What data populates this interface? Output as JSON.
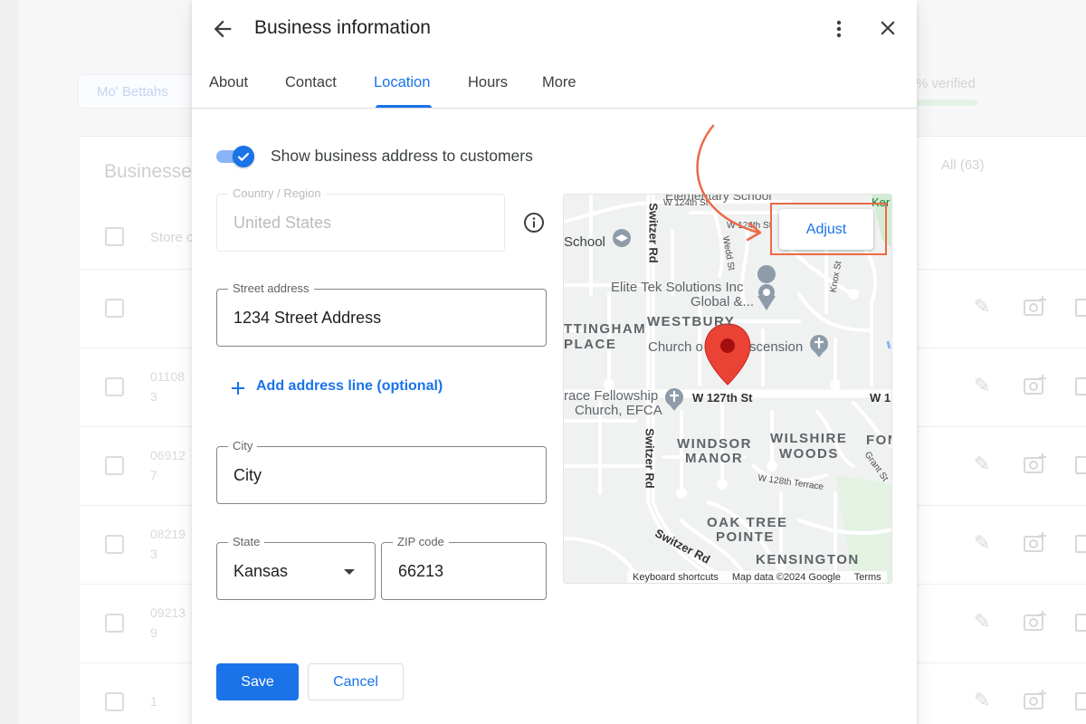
{
  "background": {
    "business_chip": "Mo' Bettahs",
    "verified_text": "% verified",
    "heading": "Businesses",
    "all_count": "All (63)",
    "store_column": "Store c",
    "rows": [
      {
        "id_line1": "",
        "id_line2": ""
      },
      {
        "id_line1": "01108",
        "id_line2": "3"
      },
      {
        "id_line1": "06912",
        "id_line2": "7"
      },
      {
        "id_line1": "08219",
        "id_line2": "3"
      },
      {
        "id_line1": "09213",
        "id_line2": "9"
      },
      {
        "id_line1": "1",
        "id_line2": ""
      }
    ]
  },
  "dialog": {
    "title": "Business information",
    "tabs": [
      {
        "label": "About"
      },
      {
        "label": "Contact"
      },
      {
        "label": "Location"
      },
      {
        "label": "Hours"
      },
      {
        "label": "More"
      }
    ],
    "active_tab": "Location",
    "toggle": {
      "label": "Show business address to customers",
      "checked": true
    },
    "country": {
      "label": "Country / Region",
      "value": "United States",
      "disabled": true
    },
    "street": {
      "label": "Street address",
      "value": "1234 Street Address"
    },
    "add_line_label": "Add address line (optional)",
    "city": {
      "label": "City",
      "value": "City"
    },
    "state": {
      "label": "State",
      "value": "Kansas"
    },
    "zip": {
      "label": "ZIP code",
      "value": "66213"
    },
    "save_label": "Save",
    "cancel_label": "Cancel"
  },
  "map": {
    "adjust_label": "Adjust",
    "labels": {
      "school_top": "Elementary School",
      "school": "School",
      "w124_1": "W 124th St",
      "w124_2": "W 124th St",
      "wedd": "Wedd St",
      "knox": "Knox St",
      "switzer_top": "Switzer Rd",
      "elite_1": "Elite Tek Solutions Inc",
      "elite_2": "Global &...",
      "tingham": "TTINGHAM",
      "place": "PLACE",
      "westbury": "WESTBURY",
      "church_asc_1": "Church o",
      "church_asc_2": "scension",
      "grace_1": "race Fellowship",
      "grace_2": "Church, EFCA",
      "w127": "W 127th St",
      "w12": "W 1",
      "windsor_1": "WINDSOR",
      "windsor_2": "MANOR",
      "wilshire_1": "WILSHIRE",
      "wilshire_2": "WOODS",
      "fon": "FON",
      "grant": "Grant St",
      "switzer_mid": "Switzer Rd",
      "w128": "W 128th Terrace",
      "oak_1": "OAK TREE",
      "oak_2": "POINTE",
      "switzer_bottom": "Switzer Rd",
      "kensington": "KENSINGTON",
      "ker": "Ker"
    },
    "footer": {
      "shortcuts": "Keyboard shortcuts",
      "mapdata": "Map data ©2024 Google",
      "terms": "Terms"
    }
  },
  "colors": {
    "accent": "#1a73e8",
    "annotation": "#ec6a47",
    "pin": "#ea4335"
  }
}
